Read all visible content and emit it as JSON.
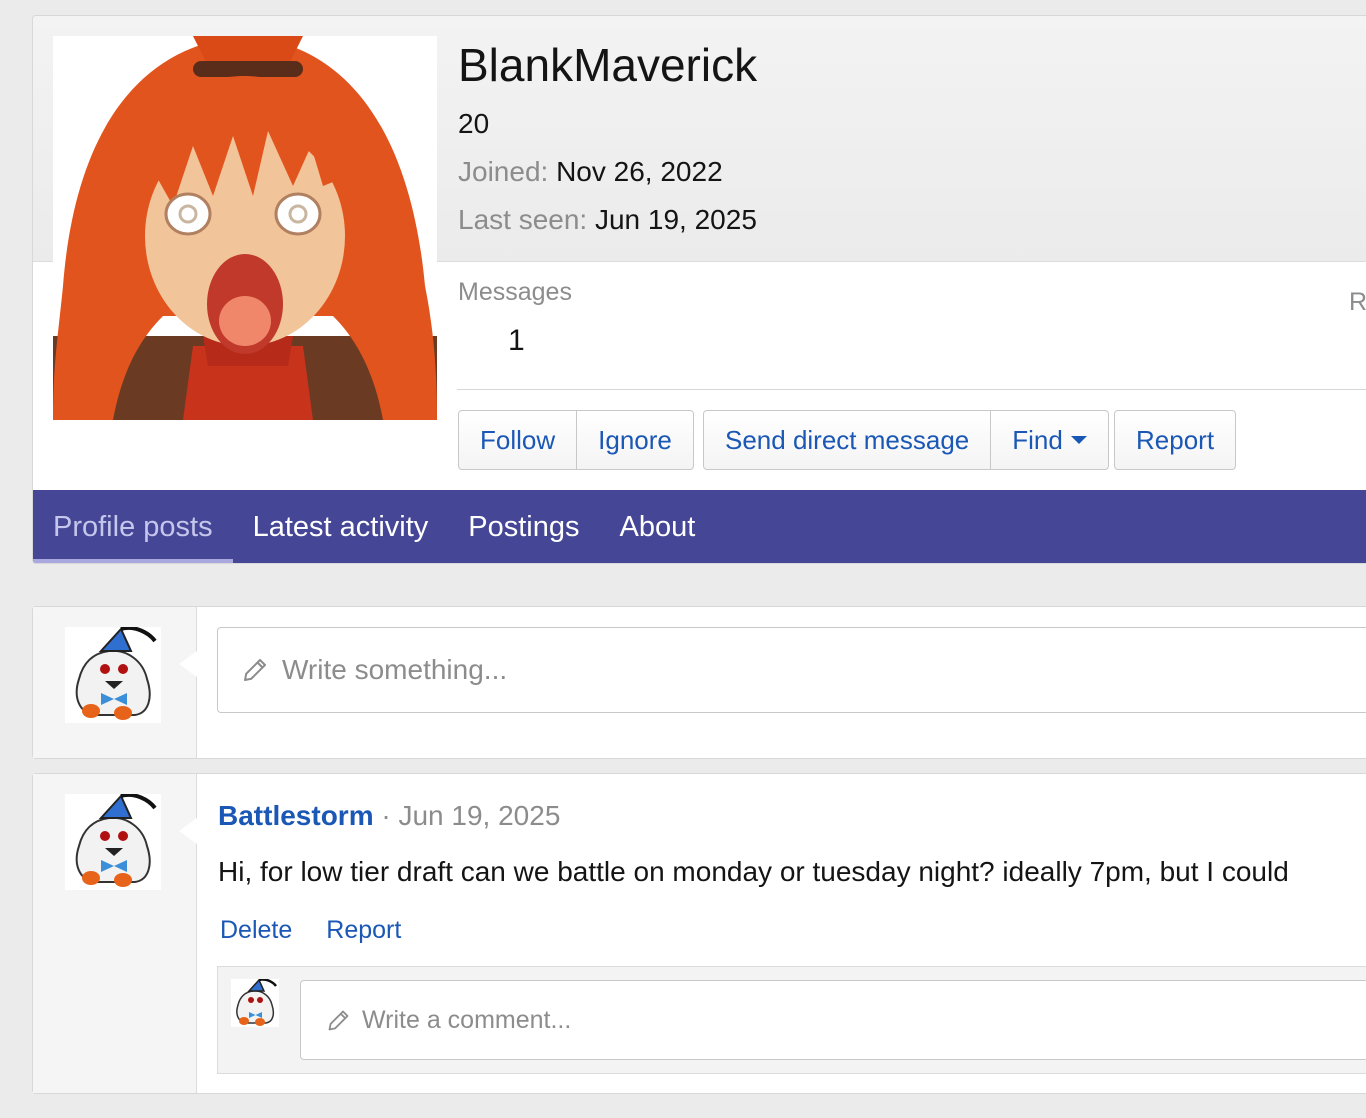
{
  "profile": {
    "username": "BlankMaverick",
    "title": "20",
    "joined_label": "Joined:",
    "joined_value": "Nov 26, 2022",
    "last_seen_label": "Last seen:",
    "last_seen_value": "Jun 19, 2025",
    "stats": {
      "messages_label": "Messages",
      "messages_value": "1",
      "next_label_partial": "R"
    },
    "buttons": {
      "follow": "Follow",
      "ignore": "Ignore",
      "send_dm": "Send direct message",
      "find": "Find",
      "report": "Report"
    }
  },
  "tabs": [
    {
      "label": "Profile posts",
      "active": true
    },
    {
      "label": "Latest activity"
    },
    {
      "label": "Postings"
    },
    {
      "label": "About"
    }
  ],
  "composer": {
    "placeholder": "Write something..."
  },
  "post": {
    "author": "Battlestorm",
    "separator": " · ",
    "date": "Jun 19, 2025",
    "body": "Hi, for low tier draft can we battle on monday or tuesday night? ideally 7pm, but I could",
    "actions": {
      "delete": "Delete",
      "report": "Report"
    },
    "comment_placeholder": "Write a comment..."
  },
  "colors": {
    "accent": "#454695",
    "link": "#1b57b5",
    "muted": "#8c8c8c",
    "avatar_hair": "#e2541e"
  },
  "icons": {
    "pencil": "pencil-icon",
    "caret": "caret-down-icon"
  }
}
